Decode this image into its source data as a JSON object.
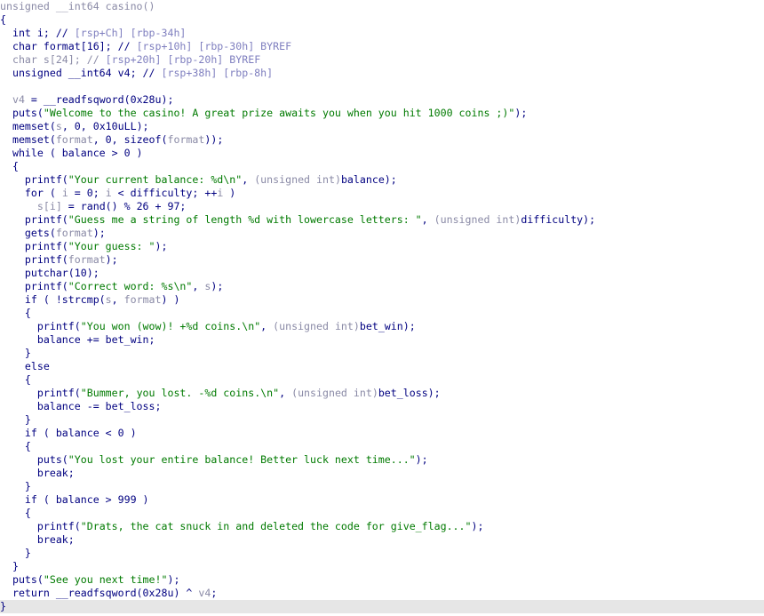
{
  "lines": [
    [
      {
        "t": "unsigned __int64 casino()",
        "c": "g"
      }
    ],
    [
      {
        "t": "{",
        "c": "p"
      }
    ],
    [
      {
        "t": "  int i; // ",
        "c": "k"
      },
      {
        "t": "[rsp+Ch] [rbp-34h]",
        "c": "c"
      }
    ],
    [
      {
        "t": "  char format[16]; // ",
        "c": "k"
      },
      {
        "t": "[rsp+10h] [rbp-30h] BYREF",
        "c": "c"
      }
    ],
    [
      {
        "t": "  char s[24]; // ",
        "c": "g"
      },
      {
        "t": "[rsp+20h] [rbp-20h] BYREF",
        "c": "c"
      }
    ],
    [
      {
        "t": "  unsigned __int64 v4; // ",
        "c": "k"
      },
      {
        "t": "[rsp+38h] [rbp-8h]",
        "c": "c"
      }
    ],
    [
      {
        "t": "",
        "c": "k"
      }
    ],
    [
      {
        "t": "  ",
        "c": "k"
      },
      {
        "t": "v4",
        "c": "v"
      },
      {
        "t": " = __readfsqword(0x28u);",
        "c": "k"
      }
    ],
    [
      {
        "t": "  puts(",
        "c": "k"
      },
      {
        "t": "\"Welcome to the casino! A great prize awaits you when you hit 1000 coins ;)\"",
        "c": "s"
      },
      {
        "t": ");",
        "c": "k"
      }
    ],
    [
      {
        "t": "  memset(",
        "c": "k"
      },
      {
        "t": "s",
        "c": "v"
      },
      {
        "t": ", 0, 0x10uLL);",
        "c": "k"
      }
    ],
    [
      {
        "t": "  memset(",
        "c": "k"
      },
      {
        "t": "format",
        "c": "v"
      },
      {
        "t": ", 0, sizeof(",
        "c": "k"
      },
      {
        "t": "format",
        "c": "v"
      },
      {
        "t": "));",
        "c": "k"
      }
    ],
    [
      {
        "t": "  while ( balance > 0 )",
        "c": "k"
      }
    ],
    [
      {
        "t": "  {",
        "c": "k"
      }
    ],
    [
      {
        "t": "    printf(",
        "c": "k"
      },
      {
        "t": "\"Your current balance: %d\\n\"",
        "c": "s"
      },
      {
        "t": ", ",
        "c": "k"
      },
      {
        "t": "(unsigned int)",
        "c": "g"
      },
      {
        "t": "balance);",
        "c": "k"
      }
    ],
    [
      {
        "t": "    for ( ",
        "c": "k"
      },
      {
        "t": "i",
        "c": "v"
      },
      {
        "t": " = 0; ",
        "c": "k"
      },
      {
        "t": "i",
        "c": "v"
      },
      {
        "t": " < difficulty; ++",
        "c": "k"
      },
      {
        "t": "i",
        "c": "v"
      },
      {
        "t": " )",
        "c": "k"
      }
    ],
    [
      {
        "t": "      ",
        "c": "k"
      },
      {
        "t": "s[i]",
        "c": "v"
      },
      {
        "t": " = rand() % 26 + 97;",
        "c": "k"
      }
    ],
    [
      {
        "t": "    printf(",
        "c": "k"
      },
      {
        "t": "\"Guess me a string of length %d with lowercase letters: \"",
        "c": "s"
      },
      {
        "t": ", ",
        "c": "k"
      },
      {
        "t": "(unsigned int)",
        "c": "g"
      },
      {
        "t": "difficulty);",
        "c": "k"
      }
    ],
    [
      {
        "t": "    gets(",
        "c": "k"
      },
      {
        "t": "format",
        "c": "v"
      },
      {
        "t": ");",
        "c": "k"
      }
    ],
    [
      {
        "t": "    printf(",
        "c": "k"
      },
      {
        "t": "\"Your guess: \"",
        "c": "s"
      },
      {
        "t": ");",
        "c": "k"
      }
    ],
    [
      {
        "t": "    printf(",
        "c": "k"
      },
      {
        "t": "format",
        "c": "v"
      },
      {
        "t": ");",
        "c": "k"
      }
    ],
    [
      {
        "t": "    putchar(10);",
        "c": "k"
      }
    ],
    [
      {
        "t": "    printf(",
        "c": "k"
      },
      {
        "t": "\"Correct word: %s\\n\"",
        "c": "s"
      },
      {
        "t": ", ",
        "c": "k"
      },
      {
        "t": "s",
        "c": "v"
      },
      {
        "t": ");",
        "c": "k"
      }
    ],
    [
      {
        "t": "    if ( !strcmp(",
        "c": "k"
      },
      {
        "t": "s",
        "c": "v"
      },
      {
        "t": ", ",
        "c": "k"
      },
      {
        "t": "format",
        "c": "v"
      },
      {
        "t": ") )",
        "c": "k"
      }
    ],
    [
      {
        "t": "    {",
        "c": "k"
      }
    ],
    [
      {
        "t": "      printf(",
        "c": "k"
      },
      {
        "t": "\"You won (wow)! +%d coins.\\n\"",
        "c": "s"
      },
      {
        "t": ", ",
        "c": "k"
      },
      {
        "t": "(unsigned int)",
        "c": "g"
      },
      {
        "t": "bet_win);",
        "c": "k"
      }
    ],
    [
      {
        "t": "      balance += bet_win;",
        "c": "k"
      }
    ],
    [
      {
        "t": "    }",
        "c": "k"
      }
    ],
    [
      {
        "t": "    else",
        "c": "k"
      }
    ],
    [
      {
        "t": "    {",
        "c": "k"
      }
    ],
    [
      {
        "t": "      printf(",
        "c": "k"
      },
      {
        "t": "\"Bummer, you lost. -%d coins.\\n\"",
        "c": "s"
      },
      {
        "t": ", ",
        "c": "k"
      },
      {
        "t": "(unsigned int)",
        "c": "g"
      },
      {
        "t": "bet_loss);",
        "c": "k"
      }
    ],
    [
      {
        "t": "      balance -= bet_loss;",
        "c": "k"
      }
    ],
    [
      {
        "t": "    }",
        "c": "k"
      }
    ],
    [
      {
        "t": "    if ( balance < 0 )",
        "c": "k"
      }
    ],
    [
      {
        "t": "    {",
        "c": "k"
      }
    ],
    [
      {
        "t": "      puts(",
        "c": "k"
      },
      {
        "t": "\"You lost your entire balance! Better luck next time...\"",
        "c": "s"
      },
      {
        "t": ");",
        "c": "k"
      }
    ],
    [
      {
        "t": "      break;",
        "c": "k"
      }
    ],
    [
      {
        "t": "    }",
        "c": "k"
      }
    ],
    [
      {
        "t": "    if ( balance > 999 )",
        "c": "k"
      }
    ],
    [
      {
        "t": "    {",
        "c": "k"
      }
    ],
    [
      {
        "t": "      printf(",
        "c": "k"
      },
      {
        "t": "\"Drats, the cat snuck in and deleted the code for give_flag...\"",
        "c": "s"
      },
      {
        "t": ");",
        "c": "k"
      }
    ],
    [
      {
        "t": "      break;",
        "c": "k"
      }
    ],
    [
      {
        "t": "    }",
        "c": "k"
      }
    ],
    [
      {
        "t": "  }",
        "c": "k"
      }
    ],
    [
      {
        "t": "  puts(",
        "c": "k"
      },
      {
        "t": "\"See you next time!\"",
        "c": "s"
      },
      {
        "t": ");",
        "c": "k"
      }
    ],
    [
      {
        "t": "  return __readfsqword(0x28u) ^ ",
        "c": "k"
      },
      {
        "t": "v4",
        "c": "v"
      },
      {
        "t": ";",
        "c": "k"
      }
    ],
    [
      {
        "t": "}",
        "c": "p"
      }
    ]
  ]
}
